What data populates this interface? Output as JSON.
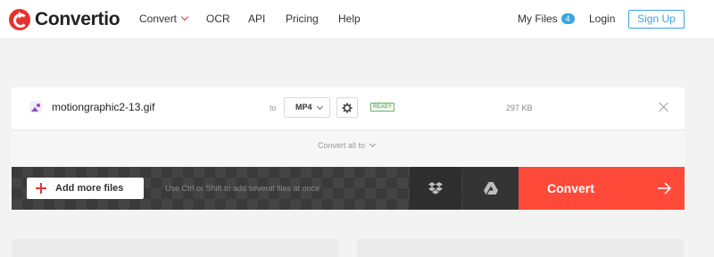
{
  "header": {
    "logo_text": "Convertio",
    "nav": {
      "convert": "Convert",
      "ocr": "OCR",
      "api": "API",
      "pricing": "Pricing",
      "help": "Help"
    },
    "my_files": "My Files",
    "my_files_count": "4",
    "login": "Login",
    "signup": "Sign Up"
  },
  "file": {
    "name": "motiongraphic2-13.gif",
    "to_label": "to",
    "format": "MP4",
    "status": "READY",
    "size": "297 KB"
  },
  "convert_all": "Convert all to",
  "actions": {
    "add_files": "Add more files",
    "hint": "Use Ctrl or Shift to add several files at once",
    "convert": "Convert"
  },
  "colors": {
    "brand_red": "#e8312f",
    "convert_button": "#ff4a3a",
    "accent_blue": "#3aa6e0",
    "ready_green": "#5cb85c"
  }
}
